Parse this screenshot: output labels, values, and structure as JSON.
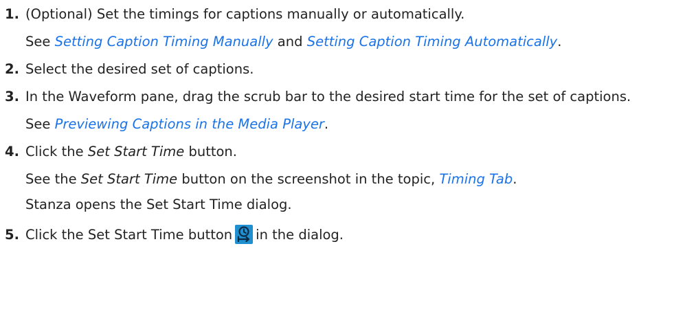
{
  "steps": [
    {
      "num": "1.",
      "text": "(Optional) Set the timings for captions manually or automatically.",
      "sub_see": "See",
      "sub_link1": "Setting Caption Timing Manually",
      "sub_and": "and",
      "sub_link2": "Setting Caption Timing Automatically",
      "sub_end": "."
    },
    {
      "num": "2.",
      "text": "Select the desired set of captions."
    },
    {
      "num": "3.",
      "text": "In the Waveform pane, drag the scrub bar to the desired start time for the set of captions.",
      "sub_see": "See",
      "sub_link": "Previewing Captions in the Media Player",
      "sub_end": "."
    },
    {
      "num": "4.",
      "text_pre": "Click the",
      "text_em": "Set Start Time",
      "text_post": "button.",
      "sub1_pre": "See the",
      "sub1_em": "Set Start Time",
      "sub1_mid": "button on the screenshot in the topic,",
      "sub1_link": "Timing Tab",
      "sub1_end": ".",
      "sub2": "Stanza opens the Set Start Time dialog."
    },
    {
      "num": "5.",
      "text_pre": "Click the Set Start Time button",
      "icon": "clock-start-icon",
      "text_post": "in the dialog."
    }
  ],
  "colors": {
    "link": "#1a73e8",
    "icon_bg": "#1f8fd0",
    "icon_fg": "#0d2a45"
  }
}
